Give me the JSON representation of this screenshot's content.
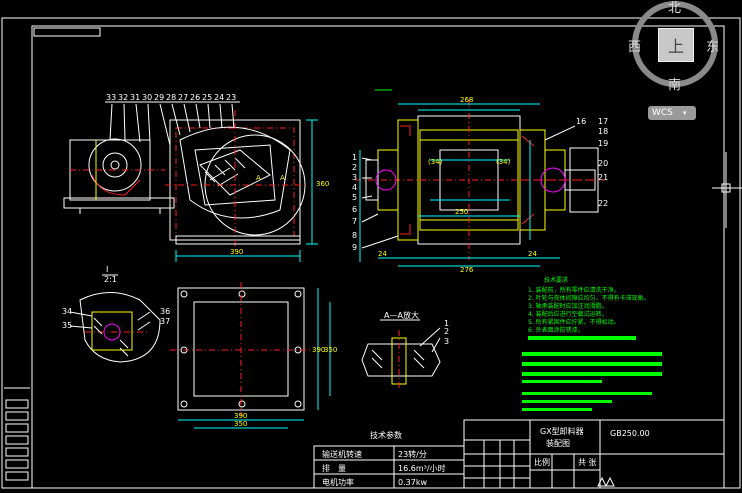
{
  "viewcube": {
    "north": "北",
    "south": "南",
    "west": "西",
    "east": "东",
    "face": "上",
    "wcs_label": "WCS"
  },
  "drawing": {
    "view_top_numbers": [
      "33",
      "32",
      "31",
      "30",
      "29",
      "28",
      "27",
      "26",
      "25",
      "24",
      "23"
    ],
    "dim_front_bottom": "390",
    "dim_front_right": "360",
    "section_left_nums": [
      "1",
      "2",
      "3",
      "4",
      "5",
      "6",
      "7",
      "8",
      "9",
      "10",
      "11",
      "12",
      "13",
      "14",
      "15"
    ],
    "section_right_nums": [
      "16",
      "17",
      "18",
      "19",
      "20",
      "21",
      "22"
    ],
    "dim_section_bottom": "276",
    "dim_section_mid": "250",
    "dim_section_top": "268",
    "detail_label_i": "I",
    "detail_scale": "2:1",
    "detail_nums": [
      "34",
      "35",
      "36",
      "37"
    ],
    "flange_dim_bottom": "390",
    "flange_dim_bottom2": "350",
    "flange_dim_right": "390",
    "flange_dim_right2": "350",
    "section_aa_label": "A—A放大",
    "section_aa_nums": [
      "1",
      "2",
      "3"
    ],
    "tech_req_title": "技术要求",
    "tech_req_items": [
      "1. 装配前，所有零件应清洗干净。",
      "2. 叶轮与壳体间隙应均匀，不得有卡滞现象。",
      "3. 轴承装配时应加注润滑脂。",
      "4. 装配后应进行空载试运转。",
      "5. 所有紧固件应拧紧，不得松动。",
      "6. 外表面涂防锈漆。"
    ]
  },
  "tech_params": {
    "title": "技术参数",
    "rows": [
      {
        "label": "输送机转速",
        "value": "23转/分"
      },
      {
        "label": "排　量",
        "value": "16.6m³/小时"
      },
      {
        "label": "电机功率",
        "value": "0.37kw"
      }
    ]
  },
  "title_block": {
    "name_top": "GX型卸料器",
    "name_bottom": "装配图",
    "code": "GB250.00",
    "scale_label": "比例",
    "sheet_label": "共 张"
  }
}
